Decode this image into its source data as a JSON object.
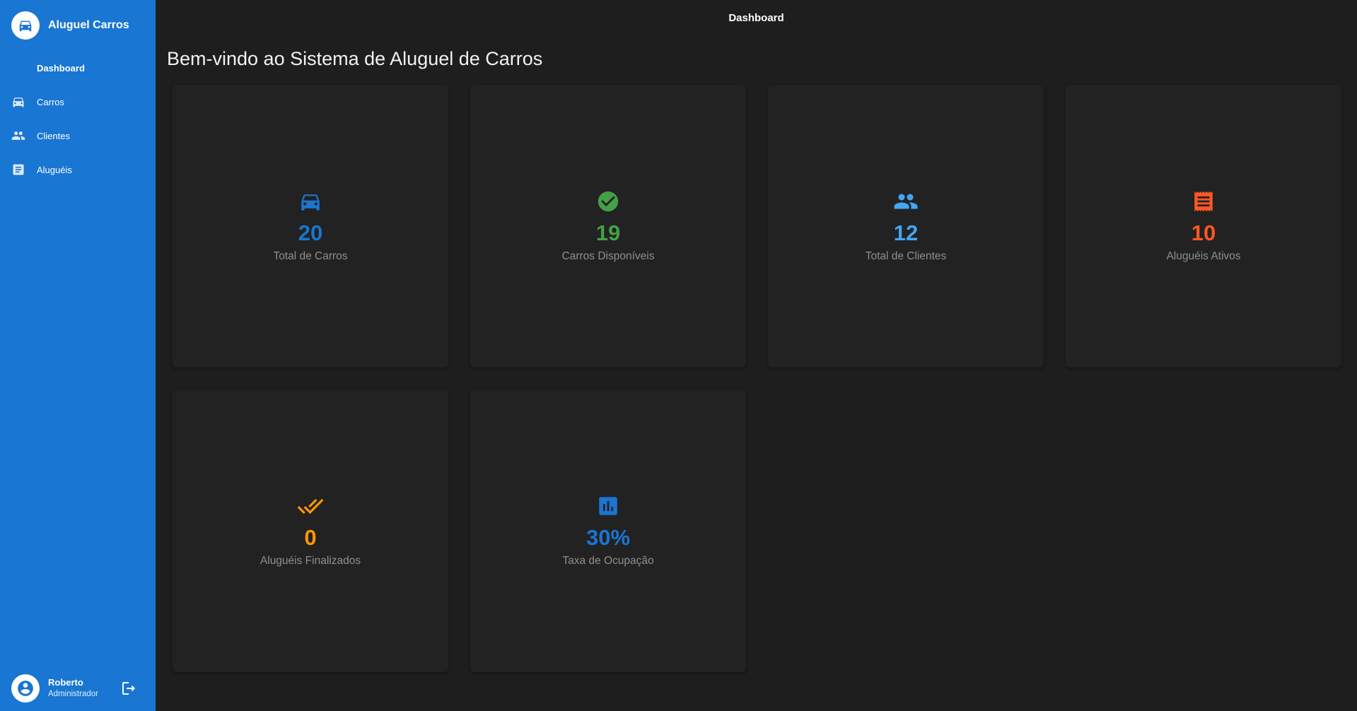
{
  "app": {
    "title": "Aluguel Carros"
  },
  "topbar": {
    "title": "Dashboard"
  },
  "sidebar": {
    "items": [
      {
        "label": "Dashboard",
        "icon": "none"
      },
      {
        "label": "Carros",
        "icon": "car-icon"
      },
      {
        "label": "Clientes",
        "icon": "people-icon"
      },
      {
        "label": "Aluguéis",
        "icon": "list-icon"
      }
    ]
  },
  "user": {
    "name": "Roberto",
    "role": "Administrador"
  },
  "welcome": "Bem-vindo ao Sistema de Aluguel de Carros",
  "colors": {
    "primary": "#1976d2",
    "blue": "#1976d2",
    "lightblue": "#42a5f5",
    "green": "#43a047",
    "orange": "#ff5722",
    "amber": "#ff9800"
  },
  "stats": [
    {
      "value": "20",
      "label": "Total de Carros",
      "icon": "car-icon",
      "color": "#1976d2"
    },
    {
      "value": "19",
      "label": "Carros Disponíveis",
      "icon": "check-circle-icon",
      "color": "#43a047"
    },
    {
      "value": "12",
      "label": "Total de Clientes",
      "icon": "people-icon",
      "color": "#42a5f5"
    },
    {
      "value": "10",
      "label": "Aluguéis Ativos",
      "icon": "receipt-icon",
      "color": "#ff5722"
    },
    {
      "value": "0",
      "label": "Aluguéis Finalizados",
      "icon": "double-check-icon",
      "color": "#ff9800"
    },
    {
      "value": "30%",
      "label": "Taxa de Ocupação",
      "icon": "bar-chart-icon",
      "color": "#1976d2"
    }
  ]
}
